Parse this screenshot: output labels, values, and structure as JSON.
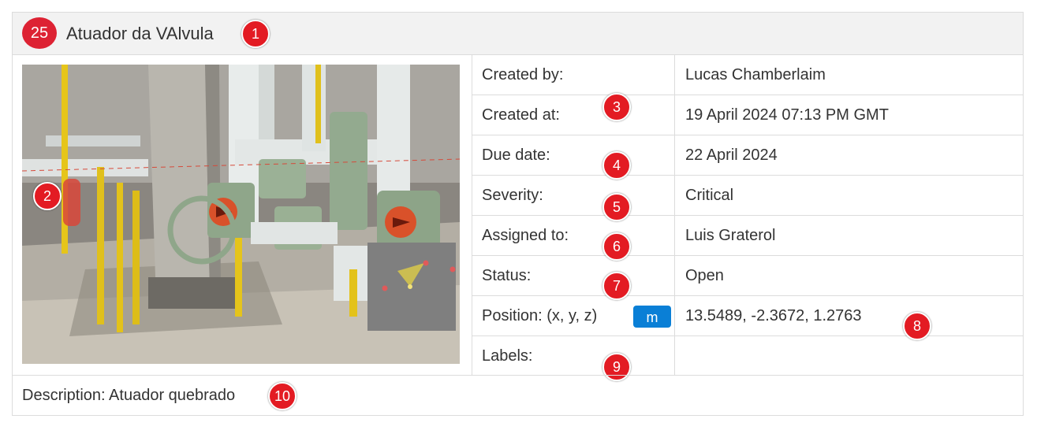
{
  "header": {
    "issue_number": "25",
    "title": "Atuador da VAlvula"
  },
  "markers": {
    "m1": "1",
    "m2": "2",
    "m3": "3",
    "m4": "4",
    "m5": "5",
    "m6": "6",
    "m7": "7",
    "m8": "8",
    "m9": "9",
    "m10": "10"
  },
  "details": {
    "created_by_label": "Created by:",
    "created_by_value": "Lucas Chamberlaim",
    "created_at_label": "Created at:",
    "created_at_value": "19 April 2024 07:13 PM GMT",
    "due_date_label": "Due date:",
    "due_date_value": "22 April 2024",
    "severity_label": "Severity:",
    "severity_value": "Critical",
    "assigned_to_label": "Assigned to:",
    "assigned_to_value": "Luis Graterol",
    "status_label": "Status:",
    "status_value": "Open",
    "position_label": "Position: (x, y, z)",
    "position_unit": "m",
    "position_value": "13.5489, -2.3672, 1.2763",
    "labels_label": "Labels:",
    "labels_value": ""
  },
  "footer": {
    "description": "Description: Atuador quebrado"
  },
  "colors": {
    "marker_red": "#e31b23",
    "badge_red": "#dd2233",
    "unit_button_blue": "#0a7fd6",
    "header_bg": "#f2f2f2",
    "border": "#dcdcdc"
  },
  "icons": {
    "photo": "panorama-photo",
    "minimap_cone": "view-cone-icon"
  }
}
